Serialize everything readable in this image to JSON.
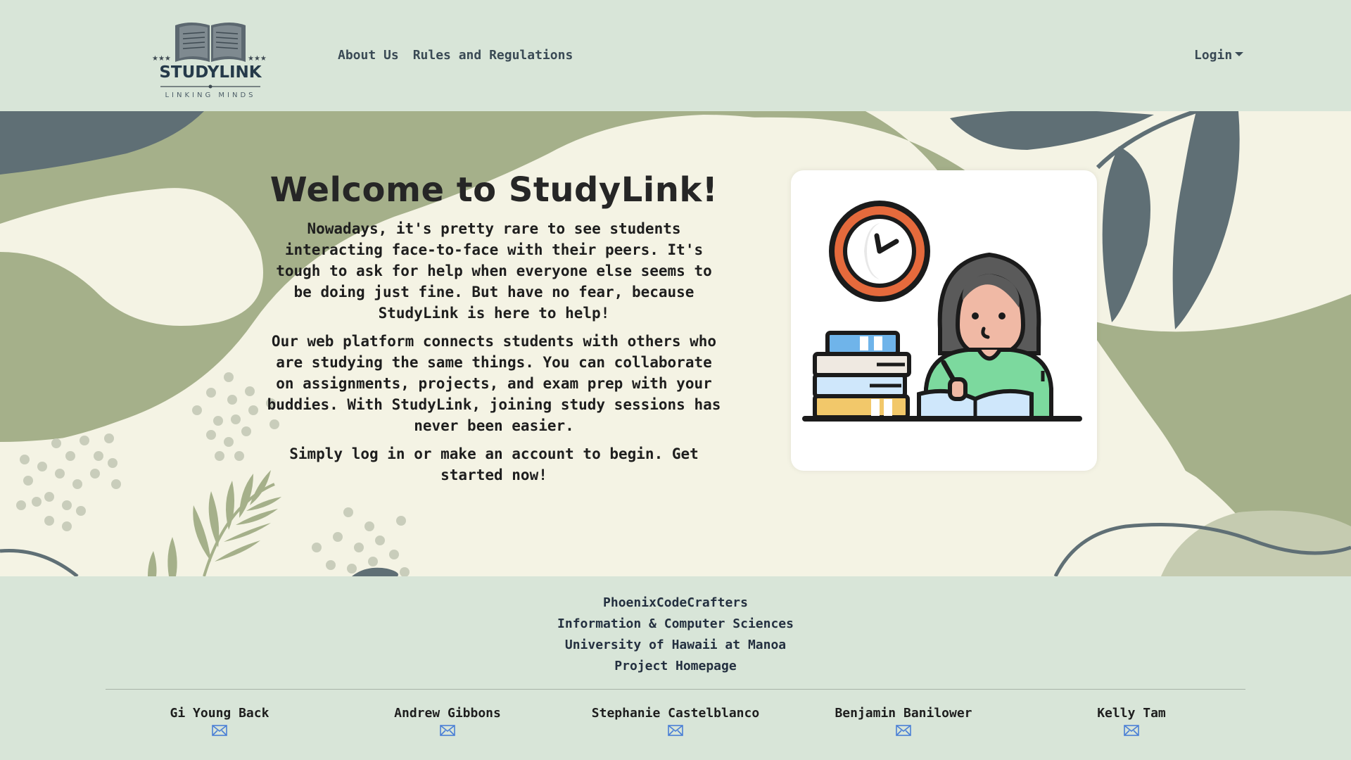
{
  "brand": {
    "name": "STUDYLINK",
    "tagline": "LINKING MINDS"
  },
  "nav": {
    "links": [
      {
        "label": "About Us"
      },
      {
        "label": "Rules and Regulations"
      }
    ],
    "login_label": "Login"
  },
  "hero": {
    "title": "Welcome to StudyLink!",
    "paragraphs": [
      "Nowadays, it's pretty rare to see students interacting face-to-face with their peers. It's tough to ask for help when everyone else seems to be doing just fine. But have no fear, because StudyLink is here to help!",
      "Our web platform connects students with others who are studying the same things. You can collaborate on assignments, projects, and exam prep with your buddies. With StudyLink, joining study sessions has never been easier.",
      "Simply log in or make an account to begin. Get started now!"
    ]
  },
  "footer": {
    "team": "PhoenixCodeCrafters",
    "department": "Information & Computer Sciences",
    "university": "University of Hawaii at Manoa",
    "homepage_label": "Project Homepage",
    "members": [
      {
        "name": "Gi Young Back",
        "icon": "mail-icon"
      },
      {
        "name": "Andrew Gibbons",
        "icon": "mail-icon"
      },
      {
        "name": "Stephanie Castelblanco",
        "icon": "mail-icon"
      },
      {
        "name": "Benjamin Banilower",
        "icon": "mail-icon"
      },
      {
        "name": "Kelly Tam",
        "icon": "mail-icon"
      }
    ]
  },
  "colors": {
    "navbar_bg": "#d8e5d8",
    "hero_bg": "#f4f3e4",
    "leaf_green": "#a5b08a",
    "slate": "#5f6f75",
    "mail_icon": "#4a7fd6"
  }
}
